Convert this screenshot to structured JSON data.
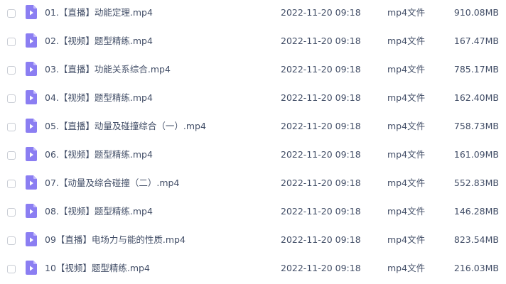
{
  "colors": {
    "icon_body": "#8b7ef2",
    "icon_fold": "#c4bcfb",
    "icon_play": "#ffffff",
    "text": "#424e67",
    "checkbox_border": "#c8ccd4"
  },
  "files": [
    {
      "name": "01.【直播】动能定理.mp4",
      "date": "2022-11-20 09:18",
      "type": "mp4文件",
      "size": "910.08MB",
      "icon": "video-file-icon"
    },
    {
      "name": "02.【视频】题型精练.mp4",
      "date": "2022-11-20 09:18",
      "type": "mp4文件",
      "size": "167.47MB",
      "icon": "video-file-icon"
    },
    {
      "name": "03.【直播】功能关系综合.mp4",
      "date": "2022-11-20 09:18",
      "type": "mp4文件",
      "size": "785.17MB",
      "icon": "video-file-icon"
    },
    {
      "name": "04.【视频】题型精练.mp4",
      "date": "2022-11-20 09:18",
      "type": "mp4文件",
      "size": "162.40MB",
      "icon": "video-file-icon"
    },
    {
      "name": "05.【直播】动量及碰撞综合（一）.mp4",
      "date": "2022-11-20 09:18",
      "type": "mp4文件",
      "size": "758.73MB",
      "icon": "video-file-icon"
    },
    {
      "name": "06.【视频】题型精练.mp4",
      "date": "2022-11-20 09:18",
      "type": "mp4文件",
      "size": "161.09MB",
      "icon": "video-file-icon"
    },
    {
      "name": "07.【动量及综合碰撞（二）.mp4",
      "date": "2022-11-20 09:18",
      "type": "mp4文件",
      "size": "552.83MB",
      "icon": "video-file-icon"
    },
    {
      "name": "08.【视频】题型精练.mp4",
      "date": "2022-11-20 09:18",
      "type": "mp4文件",
      "size": "146.28MB",
      "icon": "video-file-icon"
    },
    {
      "name": "09【直播】电场力与能的性质.mp4",
      "date": "2022-11-20 09:18",
      "type": "mp4文件",
      "size": "823.54MB",
      "icon": "video-file-icon"
    },
    {
      "name": "10【视频】题型精练.mp4",
      "date": "2022-11-20 09:18",
      "type": "mp4文件",
      "size": "216.03MB",
      "icon": "video-file-icon"
    }
  ]
}
